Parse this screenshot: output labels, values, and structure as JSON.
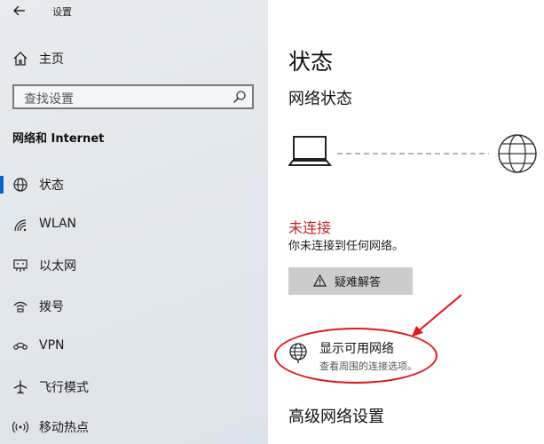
{
  "window": {
    "title": "设置"
  },
  "sidebar": {
    "home_label": "主页",
    "search_placeholder": "查找设置",
    "section_heading": "网络和 Internet",
    "items": [
      {
        "label": "状态",
        "icon": "globe-status-icon",
        "active": true
      },
      {
        "label": "WLAN",
        "icon": "wifi-icon",
        "active": false
      },
      {
        "label": "以太网",
        "icon": "ethernet-icon",
        "active": false
      },
      {
        "label": "拨号",
        "icon": "dialup-icon",
        "active": false
      },
      {
        "label": "VPN",
        "icon": "vpn-icon",
        "active": false
      },
      {
        "label": "飞行模式",
        "icon": "airplane-icon",
        "active": false
      },
      {
        "label": "移动热点",
        "icon": "hotspot-icon",
        "active": false
      }
    ]
  },
  "main": {
    "title": "状态",
    "network_status_heading": "网络状态",
    "connection_state": "未连接",
    "connection_desc": "你未连接到任何网络。",
    "troubleshoot_label": "疑难解答",
    "show_networks_title": "显示可用网络",
    "show_networks_subtitle": "查看周围的连接选项。",
    "advanced_heading": "高级网络设置"
  },
  "colors": {
    "accent": "#0a64c8",
    "error": "#c4262e",
    "annotation": "#e0161b",
    "button_bg": "#cccccc"
  }
}
